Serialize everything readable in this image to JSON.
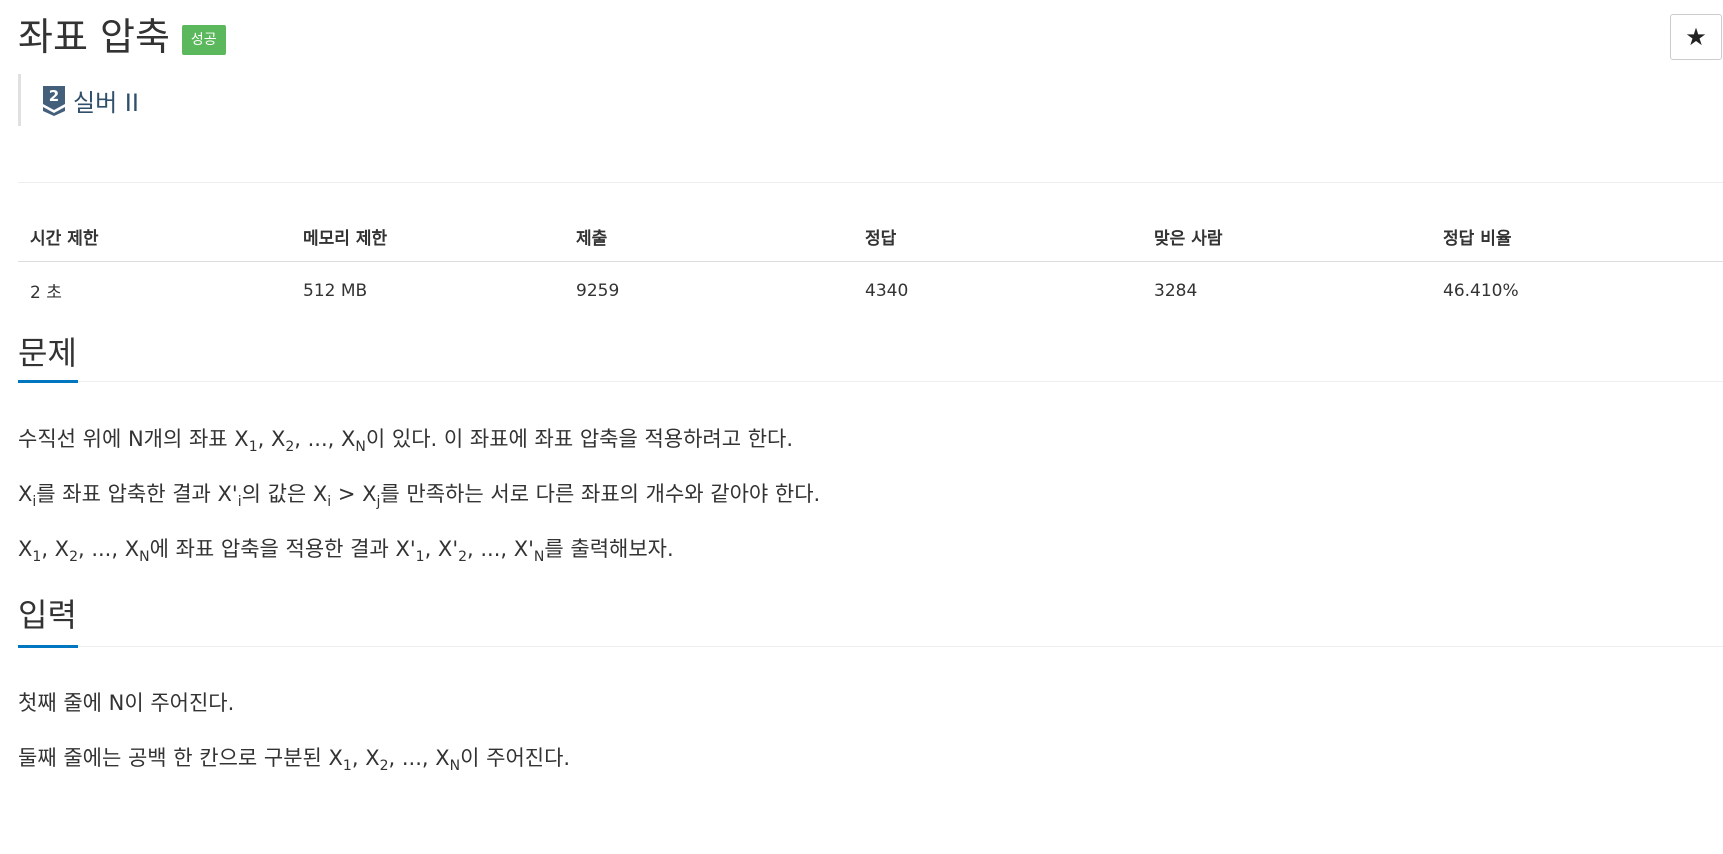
{
  "header": {
    "title": "좌표 압축",
    "badge": "성공",
    "star_icon": "★",
    "tier": {
      "level": "2",
      "name": "실버 II",
      "icon": "silver-tier-icon",
      "color": "#435f7a"
    },
    "badge_color": "#5cb85c"
  },
  "info_table": {
    "headers": [
      "시간 제한",
      "메모리 제한",
      "제출",
      "정답",
      "맞은 사람",
      "정답 비율"
    ],
    "values": [
      "2 초",
      "512 MB",
      "9259",
      "4340",
      "3284",
      "46.410%"
    ]
  },
  "problem": {
    "heading": "문제",
    "p1": {
      "a": "수직선 위에 N개의 좌표 X",
      "s1": "1",
      "b": ", X",
      "s2": "2",
      "c": ", ..., X",
      "s3": "N",
      "d": "이 있다. 이 좌표에 좌표 압축을 적용하려고 한다."
    },
    "p2": {
      "a": "X",
      "s1": "i",
      "b": "를 좌표 압축한 결과 X'",
      "s2": "i",
      "c": "의 값은 X",
      "s3": "i",
      "d": " > X",
      "s4": "j",
      "e": "를 만족하는 서로 다른 좌표의 개수와 같아야 한다."
    },
    "p3": {
      "a": "X",
      "s1": "1",
      "b": ", X",
      "s2": "2",
      "c": ", ..., X",
      "s3": "N",
      "d": "에 좌표 압축을 적용한 결과 X'",
      "s4": "1",
      "e": ", X'",
      "s5": "2",
      "f": ", ..., X'",
      "s6": "N",
      "g": "를 출력해보자."
    }
  },
  "input": {
    "heading": "입력",
    "p1": "첫째 줄에 N이 주어진다.",
    "p2": {
      "a": "둘째 줄에는 공백 한 칸으로 구분된 X",
      "s1": "1",
      "b": ", X",
      "s2": "2",
      "c": ", ..., X",
      "s3": "N",
      "d": "이 주어진다."
    }
  },
  "accent_color": "#0076c0"
}
